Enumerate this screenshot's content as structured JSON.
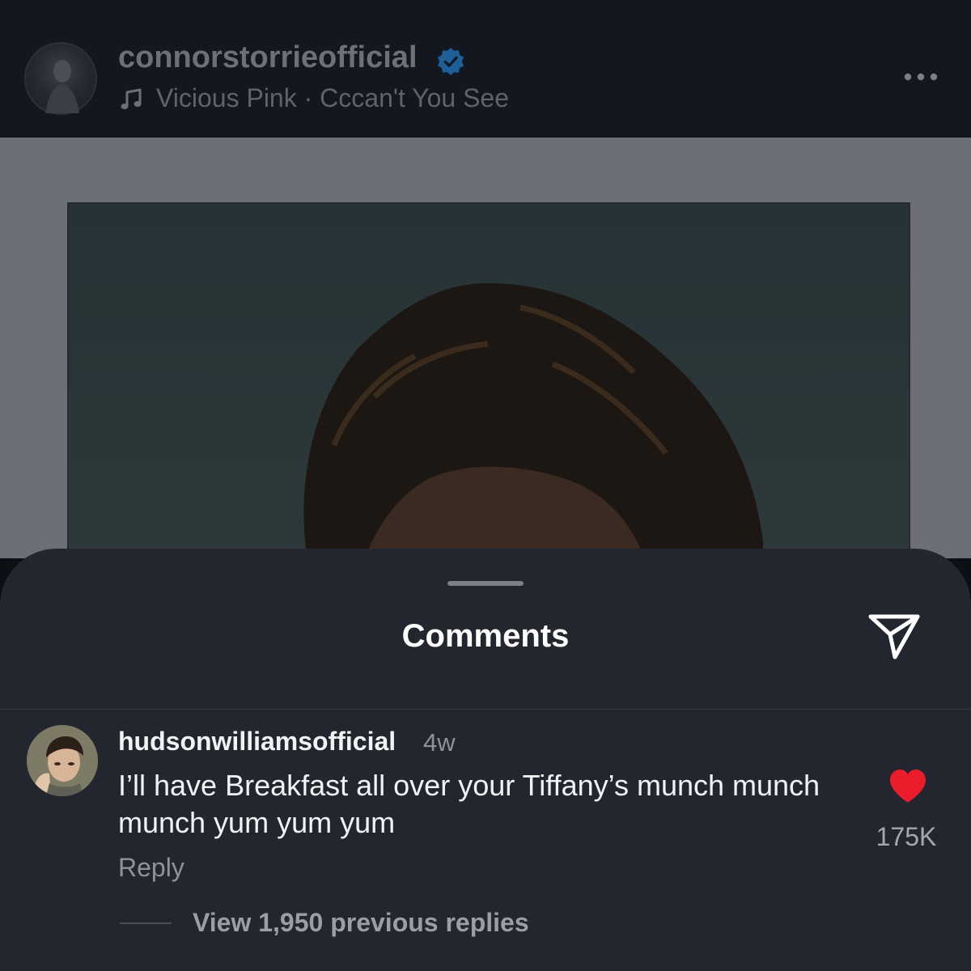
{
  "post": {
    "username": "connorstorrieofficial",
    "song": "Vicious Pink · Cccan't You See",
    "verified_color": "#3897f0"
  },
  "comments_sheet": {
    "title": "Comments",
    "comment": {
      "username": "hudsonwilliamsofficial",
      "time": "4w",
      "text": "I’ll have Breakfast all over your Tiffany’s munch munch munch yum yum yum",
      "reply_label": "Reply",
      "like_count": "175K",
      "liked": true,
      "heart_color": "#ed1c2b"
    },
    "view_replies_label": "View 1,950 previous replies"
  },
  "icons": [
    "verified-icon",
    "music-note-icon",
    "more-options-icon",
    "share-icon",
    "heart-icon"
  ]
}
